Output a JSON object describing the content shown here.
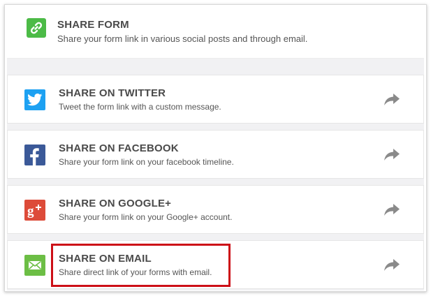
{
  "header": {
    "icon": "link-icon",
    "icon_color": "#4cbb47",
    "title": "SHARE FORM",
    "description": "Share your form link in various social posts and through email."
  },
  "items": [
    {
      "id": "twitter",
      "icon": "twitter-icon",
      "icon_color": "#1da1f2",
      "title": "SHARE ON TWITTER",
      "description": "Tweet the form link with a custom message."
    },
    {
      "id": "facebook",
      "icon": "facebook-icon",
      "icon_color": "#3b5998",
      "title": "SHARE ON FACEBOOK",
      "description": "Share your form link on your facebook timeline."
    },
    {
      "id": "google-plus",
      "icon": "google-plus-icon",
      "icon_color": "#dd4b39",
      "title": "SHARE ON GOOGLE+",
      "description": "Share your form link on your Google+ account."
    },
    {
      "id": "email",
      "icon": "envelope-icon",
      "icon_color": "#6cbe45",
      "title": "SHARE ON EMAIL",
      "description": "Share direct link of your forms with email.",
      "highlighted": true
    }
  ],
  "colors": {
    "highlight": "#cc0f17",
    "arrow": "#8a8a8a"
  }
}
